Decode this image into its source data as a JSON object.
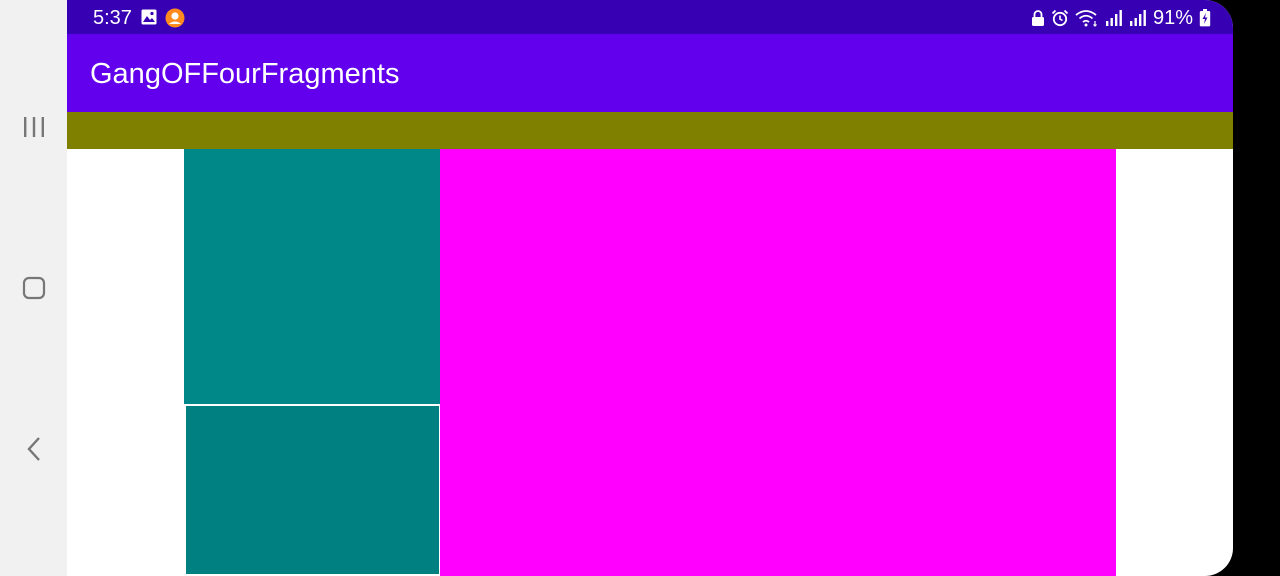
{
  "status_bar": {
    "time": "5:37",
    "battery_percent": "91%",
    "left_icons": [
      "gallery-icon",
      "app-notification-icon"
    ],
    "right_icons": [
      "lock-icon",
      "alarm-icon",
      "wifi-icon",
      "signal-icon",
      "signal-icon",
      "battery-icon"
    ]
  },
  "app_bar": {
    "title": "GangOFFourFragments"
  },
  "fragments": {
    "top_color": "#808000",
    "left_top_color": "#008787",
    "left_bottom_color": "#008080",
    "right_color": "#ff00ff"
  },
  "nav_bar": {
    "buttons": [
      "recents-icon",
      "home-icon",
      "back-icon"
    ]
  },
  "colors": {
    "status_bar": "#3700b3",
    "app_bar": "#6200ee",
    "nav_bar": "#f1f1f1",
    "screen_background": "#ffffff"
  }
}
